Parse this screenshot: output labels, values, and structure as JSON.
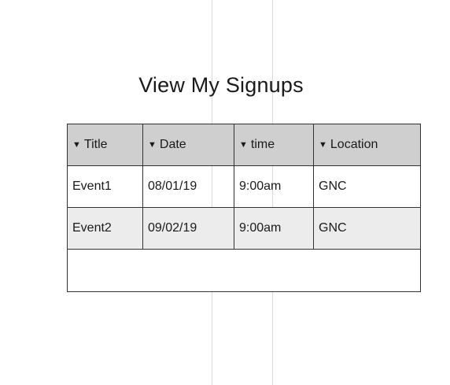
{
  "page": {
    "title": "View My Signups"
  },
  "table": {
    "sort_icon": "sort-down-triangle",
    "columns": [
      {
        "key": "title",
        "label": "Title"
      },
      {
        "key": "date",
        "label": "Date"
      },
      {
        "key": "time",
        "label": "time"
      },
      {
        "key": "location",
        "label": "Location"
      }
    ],
    "rows": [
      {
        "title": "Event1",
        "date": "08/01/19",
        "time": "9:00am",
        "location": "GNC"
      },
      {
        "title": "Event2",
        "date": "09/02/19",
        "time": "9:00am",
        "location": "GNC"
      }
    ]
  }
}
